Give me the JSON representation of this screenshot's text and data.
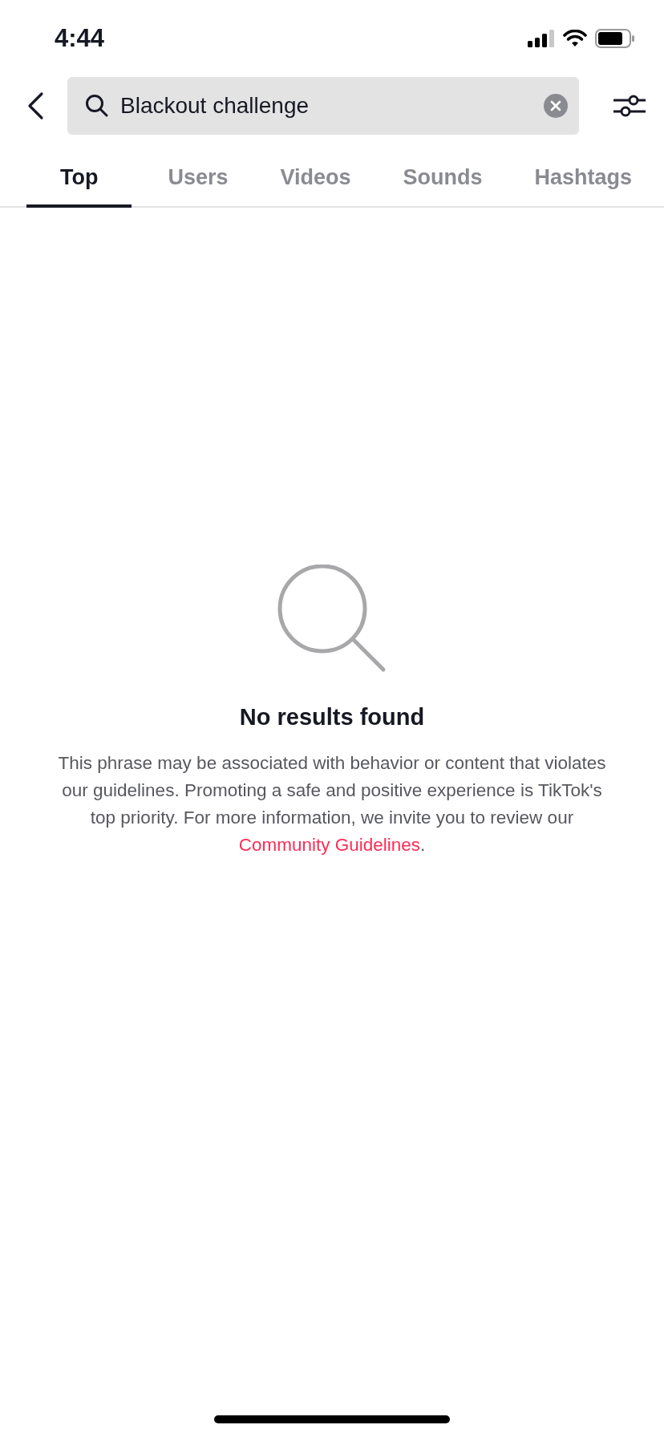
{
  "status_bar": {
    "time": "4:44"
  },
  "search": {
    "value": "Blackout challenge"
  },
  "tabs": [
    {
      "label": "Top",
      "selected": true
    },
    {
      "label": "Users",
      "selected": false
    },
    {
      "label": "Videos",
      "selected": false
    },
    {
      "label": "Sounds",
      "selected": false
    },
    {
      "label": "Hashtags",
      "selected": false
    }
  ],
  "empty_state": {
    "title": "No results found",
    "message": "This phrase may be associated with behavior or content that violates our guidelines. Promoting a safe and positive experience is TikTok's top priority. For more information, we invite you to review our",
    "link": "Community Guidelines",
    "message_end": "."
  }
}
